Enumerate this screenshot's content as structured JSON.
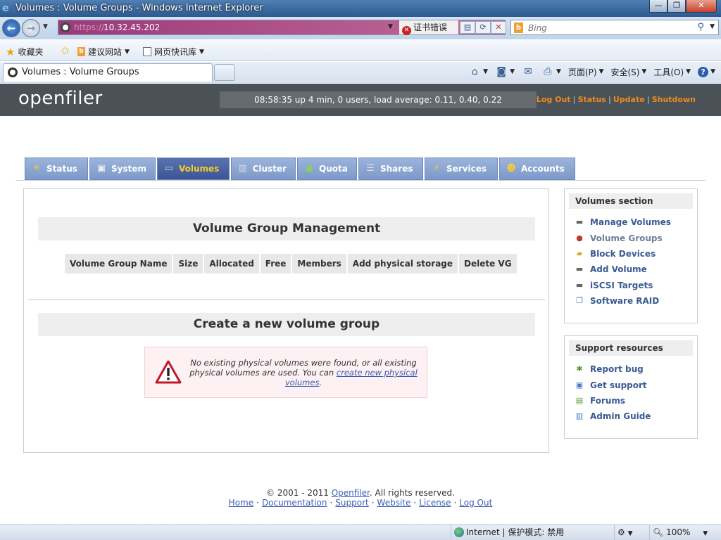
{
  "window": {
    "title": "Volumes : Volume Groups - Windows Internet Explorer",
    "minimize": "—",
    "maximize": "❐",
    "close": "✕"
  },
  "address_bar": {
    "protocol": "https://",
    "url": "10.32.45.202",
    "cert_error": "证书错误"
  },
  "search": {
    "placeholder": "Bing"
  },
  "favorites_bar": {
    "favorites_label": "收藏夹",
    "suggested_sites": "建议网站",
    "web_slice_gallery": "网页快讯库"
  },
  "tab": {
    "label": "Volumes : Volume Groups"
  },
  "command_bar": {
    "page": "页面(P)",
    "safety": "安全(S)",
    "tools": "工具(O)"
  },
  "openfiler": {
    "logo": "openfiler",
    "uptime": "08:58:35 up 4 min, 0 users, load average: 0.11, 0.40, 0.22",
    "top_links": [
      "Log Out",
      "Status",
      "Update",
      "Shutdown"
    ]
  },
  "nav_tabs": [
    {
      "label": "Status",
      "icon": "sun-cloud-icon"
    },
    {
      "label": "System",
      "icon": "monitor-icon"
    },
    {
      "label": "Volumes",
      "icon": "disk-icon"
    },
    {
      "label": "Cluster",
      "icon": "cluster-icon"
    },
    {
      "label": "Quota",
      "icon": "pie-icon"
    },
    {
      "label": "Shares",
      "icon": "server-icon"
    },
    {
      "label": "Services",
      "icon": "lightning-icon"
    },
    {
      "label": "Accounts",
      "icon": "users-icon"
    }
  ],
  "main": {
    "vg_management_title": "Volume Group Management",
    "table_headers": [
      "Volume Group Name",
      "Size",
      "Allocated",
      "Free",
      "Members",
      "Add physical storage",
      "Delete VG"
    ],
    "create_title": "Create a new volume group",
    "warning_text": "No existing physical volumes were found, or all existing physical volumes are used. You can ",
    "warning_link": "create new physical volumes",
    "warning_end": "."
  },
  "volumes_section": {
    "title": "Volumes section",
    "items": [
      "Manage Volumes",
      "Volume Groups",
      "Block Devices",
      "Add Volume",
      "iSCSI Targets",
      "Software RAID"
    ]
  },
  "support_resources": {
    "title": "Support resources",
    "items": [
      "Report bug",
      "Get support",
      "Forums",
      "Admin Guide"
    ]
  },
  "footer": {
    "copyright_pre": "© 2001 - 2011 ",
    "copyright_link": "Openfiler",
    "copyright_post": ". All rights reserved.",
    "links": [
      "Home",
      "Documentation",
      "Support",
      "Website",
      "License",
      "Log Out"
    ]
  },
  "status_bar": {
    "zone": "Internet | 保护模式: 禁用",
    "zoom": "100%"
  }
}
